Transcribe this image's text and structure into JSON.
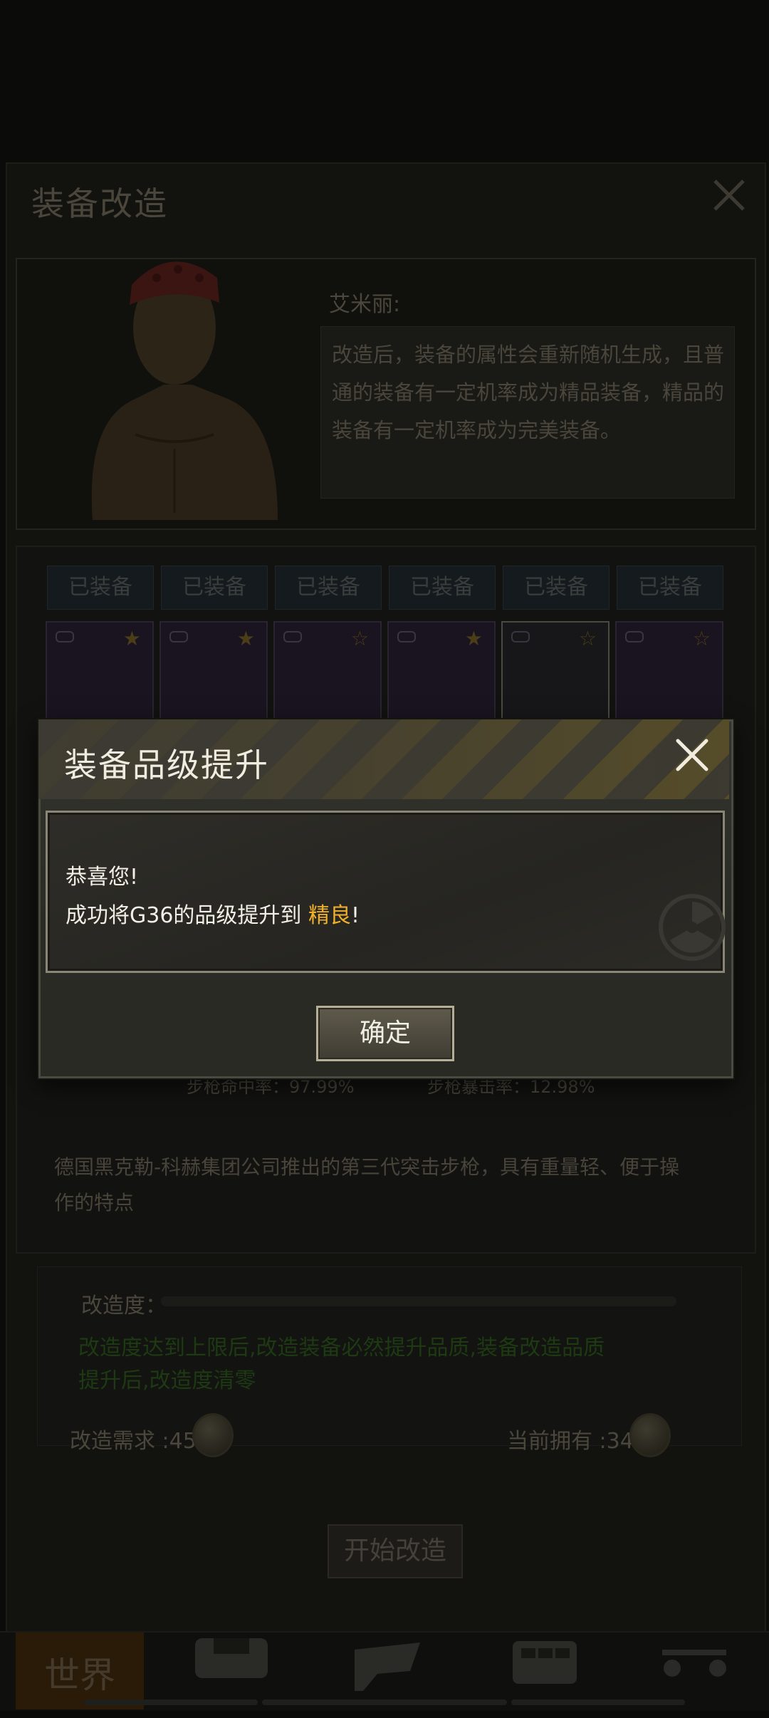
{
  "background": {
    "panel_title": "装备改造",
    "npc": {
      "name": "艾米丽:",
      "speech": "改造后，装备的属性会重新随机生成，且普通的装备有一定机率成为精品装备，精品的装备有一定机率成为完美装备。"
    },
    "equipped_tabs": [
      "已装备",
      "已装备",
      "已装备",
      "已装备",
      "已装备",
      "已装备"
    ],
    "stats": {
      "left": "步枪命中率：97.99%",
      "right": "步枪暴击率：12.98%"
    },
    "item_description": "德国黑克勒-科赫集团公司推出的第三代突击步枪，具有重量轻、便于操作的特点",
    "modification": {
      "label": "改造度：",
      "progress": 0,
      "note": "改造度达到上限后,改造装备必然提升品质,装备改造品质提升后,改造度清零",
      "requirement": "改造需求 :45",
      "owned": "当前拥有 :34",
      "start_button": "开始改造"
    },
    "bottom_nav": {
      "world": "世界"
    }
  },
  "modal": {
    "title": "装备品级提升",
    "line1": "恭喜您!",
    "line2_prefix": "成功将G36的品级提升到 ",
    "line2_quality": "精良",
    "line2_suffix": "!",
    "confirm_button": "确定"
  },
  "colors": {
    "quality_highlight": "#f0b12a",
    "modal_text": "#f2efe6"
  }
}
